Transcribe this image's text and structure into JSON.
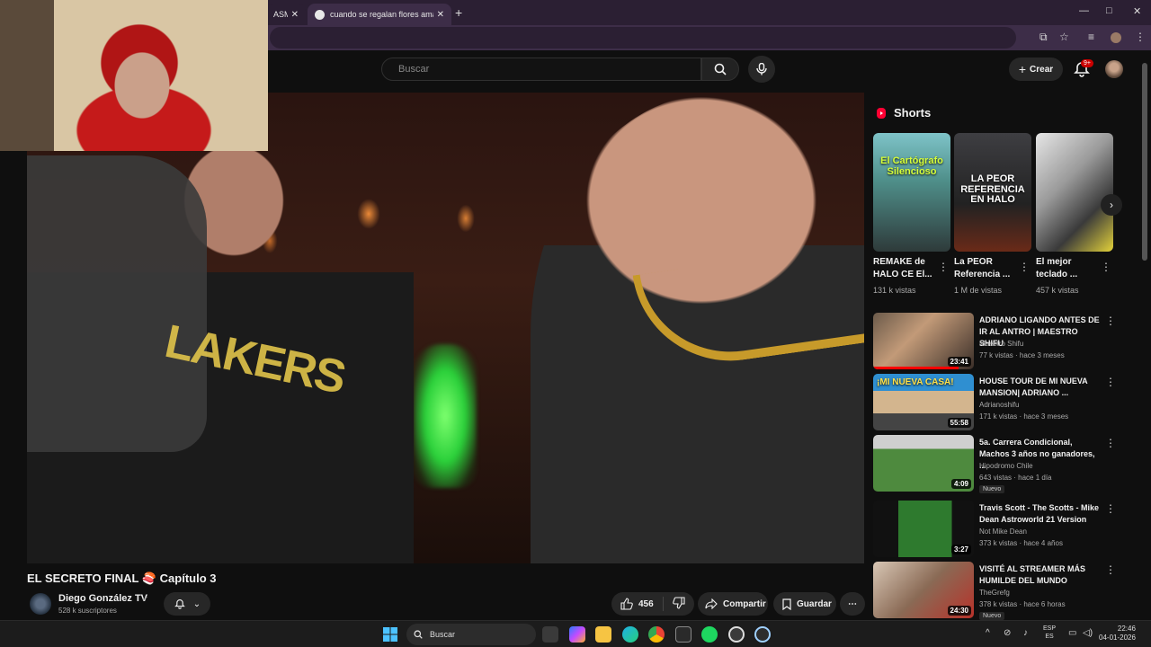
{
  "browser": {
    "tabs": [
      {
        "title": "ASM"
      },
      {
        "title": "cuando se regalan flores amarillas"
      }
    ],
    "new_tab_symbol": "+",
    "close_symbol": "✕",
    "window_controls": [
      "—",
      "□",
      "✕"
    ]
  },
  "header": {
    "search_placeholder": "Buscar",
    "create_label": "Crear",
    "notification_badge": "9+"
  },
  "video": {
    "title": "EL SECRETO FINAL 🍣 Capítulo 3",
    "channel": "Diego González TV",
    "subscribers": "528 k suscriptores",
    "likes": "456",
    "share_label": "Compartir",
    "save_label": "Guardar",
    "jersey_text": "LAKERS"
  },
  "shorts": {
    "heading": "Shorts",
    "items": [
      {
        "thumb_text": "El Cartógrafo Silencioso",
        "title": "REMAKE de HALO CE El...",
        "views": "131 k vistas"
      },
      {
        "thumb_text": "LA PEOR REFERENCIA EN HALO",
        "title": "La PEOR Referencia ...",
        "views": "1 M de vistas"
      },
      {
        "thumb_text": "",
        "title": "El mejor teclado ...",
        "views": "457 k vistas"
      }
    ]
  },
  "recommendations": [
    {
      "title": "ADRIANO LIGANDO ANTES DE IR AL ANTRO | MAESTRO SHIFU",
      "channel": "Maestro Shifu",
      "meta": "77 k vistas · hace 3 meses",
      "duration": "23:41",
      "badge": "",
      "progress": 0.85
    },
    {
      "title": "HOUSE TOUR DE MI NUEVA MANSION| ADRIANO ...",
      "channel": "Adrianoshifu",
      "meta": "171 k vistas · hace 3 meses",
      "duration": "55:58",
      "badge": "",
      "progress": 0,
      "thumb_text": "¡MI NUEVA CASA!"
    },
    {
      "title": "5a. Carrera Condicional, Machos 3 años no ganadores, ...",
      "channel": "Hipodromo Chile",
      "meta": "643 vistas · hace 1 día",
      "duration": "4:09",
      "badge": "Nuevo",
      "progress": 0
    },
    {
      "title": "Travis Scott - The Scotts - Mike Dean Astroworld 21 Version",
      "channel": "Not Mike Dean",
      "meta": "373 k vistas · hace 4 años",
      "duration": "3:27",
      "badge": "",
      "progress": 0
    },
    {
      "title": "VISITÉ AL STREAMER MÁS HUMILDE DEL MUNDO",
      "channel": "TheGrefg",
      "meta": "378 k vistas · hace 6 horas",
      "duration": "24:30",
      "badge": "Nuevo",
      "progress": 0
    }
  ],
  "taskbar": {
    "search_placeholder": "Buscar",
    "lang_line1": "ESP",
    "lang_line2": "ES",
    "time": "22:46",
    "date": "04-01-2026"
  },
  "colors": {
    "accent_red": "#ff0000",
    "chain_gold": "#c79a2a",
    "glow_green": "#2bd03a"
  }
}
